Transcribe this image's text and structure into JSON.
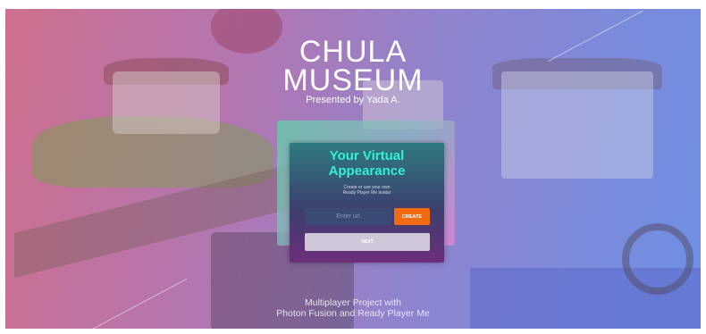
{
  "title": {
    "line1": "CHULA",
    "line2": "MUSEUM",
    "subtitle": "Presented by Yada A."
  },
  "dialog": {
    "heading_line1": "Your Virtual",
    "heading_line2": "Appearance",
    "description_line1": "Create or use your own",
    "description_line2": "Ready Player Me avatar",
    "url_input": {
      "value": "",
      "placeholder": "Enter url"
    },
    "create_label": "CREATE",
    "next_label": "NEXT"
  },
  "footer": {
    "line1": "Multiplayer Project with",
    "line2": "Photon Fusion and Ready Player Me"
  },
  "colors": {
    "heading": "#31f0d8",
    "create_button": "#f26a12",
    "next_button": "#cfc8d8"
  }
}
